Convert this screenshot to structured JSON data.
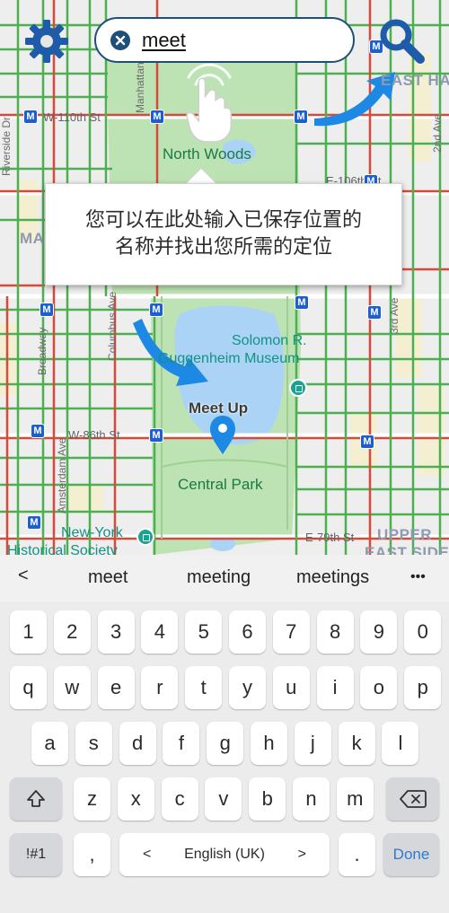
{
  "map": {
    "street_labels": {
      "w110": "W-110th St",
      "w86": "W-86th St",
      "e106": "E-106th St",
      "e79": "E-79th St",
      "broadway": "Broadway",
      "columbus": "Columbus Ave",
      "amsterdam": "Amsterdam Ave",
      "riverside": "Riverside Dr",
      "manhattan_ave": "Manhattan Ave",
      "second_ave": "2nd Ave",
      "third_ave": "3rd Ave"
    },
    "districts": {
      "east_harlem": "EAST HA",
      "manhattan_valley": "MA",
      "upper_east_side_1": "UPPER",
      "upper_east_side_2": "EAST SIDE"
    },
    "parks": {
      "north_woods": "North Woods",
      "central_park": "Central Park",
      "guggenheim_1": "Solomon R.",
      "guggenheim_2": "Guggenheim Museum",
      "nyhs_1": "New-York",
      "nyhs_2": "Historical Society"
    },
    "metro_letter": "M",
    "marker_label": "Meet Up",
    "colors": {
      "park": "#bde3b4",
      "water": "#aad3f5",
      "road_green": "#4caf50",
      "road_red": "#d64a3b",
      "brand_blue": "#1e88e5",
      "dark_blue": "#1e4f7a"
    }
  },
  "topbar": {
    "settings_icon": "gear-icon",
    "search_value": "meet",
    "search_icon": "magnifier-icon"
  },
  "tooltip": {
    "line1": "您可以在此处输入已保存位置的",
    "line2": "名称并找出您所需的定位"
  },
  "keyboard": {
    "suggestions": [
      "meet",
      "meeting",
      "meetings"
    ],
    "more": "•••",
    "back": "<",
    "row_numbers": [
      "1",
      "2",
      "3",
      "4",
      "5",
      "6",
      "7",
      "8",
      "9",
      "0"
    ],
    "row_q": [
      "q",
      "w",
      "e",
      "r",
      "t",
      "y",
      "u",
      "i",
      "o",
      "p"
    ],
    "row_a": [
      "a",
      "s",
      "d",
      "f",
      "g",
      "h",
      "j",
      "k",
      "l"
    ],
    "row_z": [
      "z",
      "x",
      "c",
      "v",
      "b",
      "n",
      "m"
    ],
    "symbols": "!#1",
    "comma": ",",
    "language": "English (UK)",
    "lang_prev": "<",
    "lang_next": ">",
    "period": ".",
    "done": "Done"
  }
}
